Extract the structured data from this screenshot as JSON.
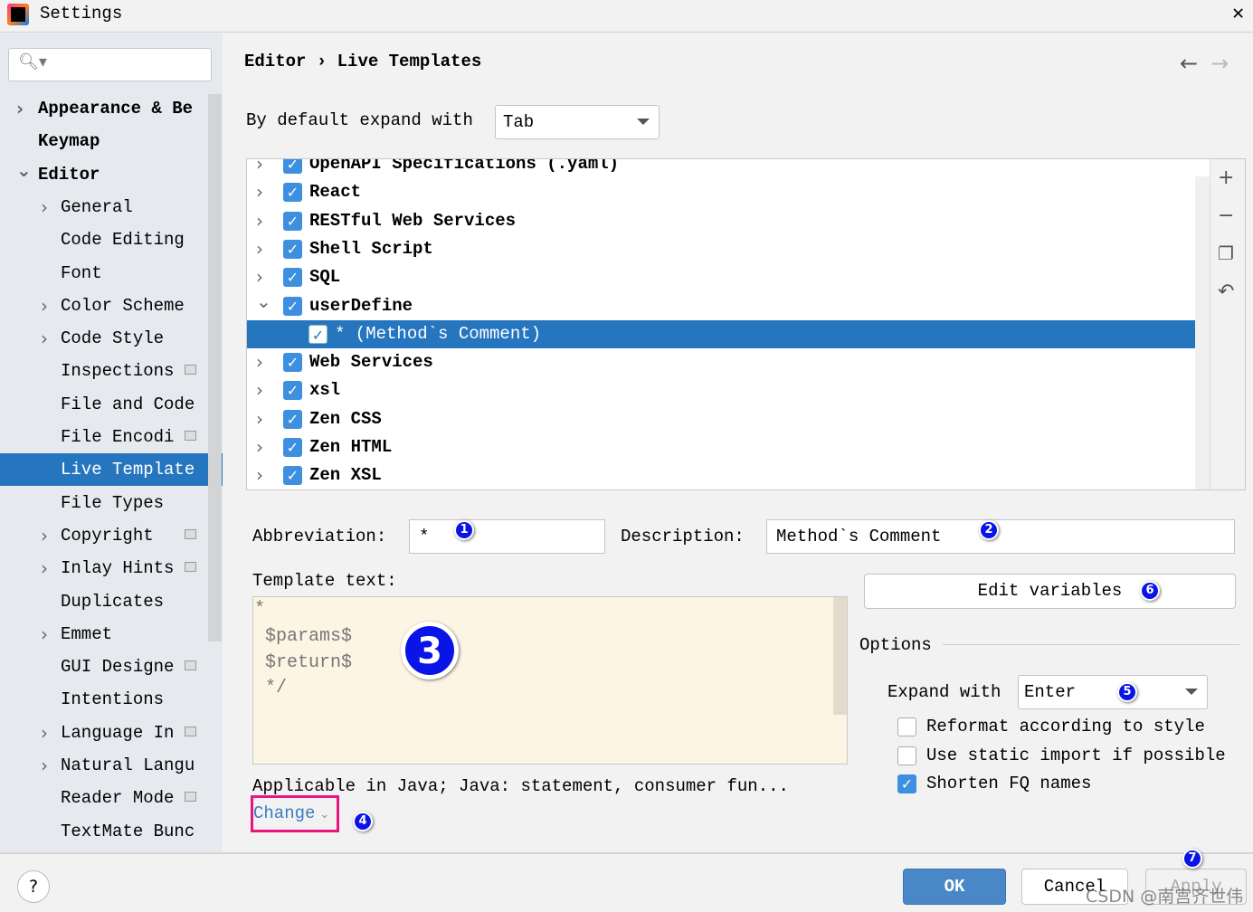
{
  "window": {
    "title": "Settings",
    "close_icon": "close-icon"
  },
  "sidebar": {
    "search_placeholder": "",
    "items": [
      {
        "label": "Appearance & Be",
        "bold": true,
        "chevron": "right",
        "indent": 0
      },
      {
        "label": "Keymap",
        "bold": true,
        "chevron": "",
        "indent": 0
      },
      {
        "label": "Editor",
        "bold": true,
        "chevron": "down",
        "indent": 0
      },
      {
        "label": "General",
        "chevron": "right",
        "indent": 1
      },
      {
        "label": "Code Editing",
        "chevron": "",
        "indent": 1
      },
      {
        "label": "Font",
        "chevron": "",
        "indent": 1
      },
      {
        "label": "Color Scheme",
        "chevron": "right",
        "indent": 1
      },
      {
        "label": "Code Style",
        "chevron": "right",
        "indent": 1
      },
      {
        "label": "Inspections",
        "chevron": "",
        "indent": 1,
        "project": true
      },
      {
        "label": "File and Code",
        "chevron": "",
        "indent": 1
      },
      {
        "label": "File Encodi",
        "chevron": "",
        "indent": 1,
        "project": true
      },
      {
        "label": "Live Template",
        "chevron": "",
        "indent": 1,
        "selected": true
      },
      {
        "label": "File Types",
        "chevron": "",
        "indent": 1
      },
      {
        "label": "Copyright",
        "chevron": "right",
        "indent": 1,
        "project": true
      },
      {
        "label": "Inlay Hints",
        "chevron": "right",
        "indent": 1,
        "project": true
      },
      {
        "label": "Duplicates",
        "chevron": "",
        "indent": 1
      },
      {
        "label": "Emmet",
        "chevron": "right",
        "indent": 1
      },
      {
        "label": "GUI Designe",
        "chevron": "",
        "indent": 1,
        "project": true
      },
      {
        "label": "Intentions",
        "chevron": "",
        "indent": 1
      },
      {
        "label": "Language In",
        "chevron": "right",
        "indent": 1,
        "project": true
      },
      {
        "label": "Natural Langu",
        "chevron": "right",
        "indent": 1
      },
      {
        "label": "Reader Mode",
        "chevron": "",
        "indent": 1,
        "project": true
      },
      {
        "label": "TextMate Bunc",
        "chevron": "",
        "indent": 1
      }
    ]
  },
  "breadcrumb": {
    "parent": "Editor",
    "separator": "›",
    "current": "Live Templates"
  },
  "expand": {
    "label": "By default expand with",
    "value": "Tab"
  },
  "tree": [
    {
      "label": "OpenAPI Specifications (.yaml)",
      "checked": true,
      "chevron": "right"
    },
    {
      "label": "React",
      "checked": true,
      "chevron": "right"
    },
    {
      "label": "RESTful Web Services",
      "checked": true,
      "chevron": "right"
    },
    {
      "label": "Shell Script",
      "checked": true,
      "chevron": "right"
    },
    {
      "label": "SQL",
      "checked": true,
      "chevron": "right"
    },
    {
      "label": "userDefine",
      "checked": true,
      "chevron": "down"
    },
    {
      "label": "*  (Method`s Comment)",
      "checked": true,
      "child": true,
      "selected": true
    },
    {
      "label": "Web Services",
      "checked": true,
      "chevron": "right"
    },
    {
      "label": "xsl",
      "checked": true,
      "chevron": "right"
    },
    {
      "label": "Zen CSS",
      "checked": true,
      "chevron": "right"
    },
    {
      "label": "Zen HTML",
      "checked": true,
      "chevron": "right"
    },
    {
      "label": "Zen XSL",
      "checked": true,
      "chevron": "right"
    }
  ],
  "tree_tools": [
    "add-icon",
    "remove-icon",
    "copy-icon",
    "restore-icon"
  ],
  "editor": {
    "abbreviation_label": "Abbreviation:",
    "abbreviation": "*",
    "description_label": "Description:",
    "description": "Method`s Comment",
    "template_label": "Template text:",
    "template_lines": [
      "*",
      " $params$",
      " $return$",
      " */"
    ],
    "applicable": "Applicable in Java; Java: statement, consumer fun...",
    "change": "Change",
    "edit_variables": "Edit variables",
    "options_label": "Options",
    "expand_with_label": "Expand with",
    "expand_with": "Enter",
    "options": [
      {
        "label": "Reformat according to style",
        "checked": false
      },
      {
        "label": "Use static import if possible",
        "checked": false
      },
      {
        "label": "Shorten FQ names",
        "checked": true
      }
    ]
  },
  "badges": [
    "1",
    "2",
    "3",
    "4",
    "5",
    "6",
    "7"
  ],
  "footer": {
    "help": "?",
    "ok": "OK",
    "cancel": "Cancel",
    "apply": "Apply"
  },
  "watermark": "CSDN @南宫齐世伟",
  "colors": {
    "selection": "#2675bf",
    "badge": "#0a14e6",
    "highlight_box": "#e8157f",
    "template_bg": "#fcf5e3"
  }
}
